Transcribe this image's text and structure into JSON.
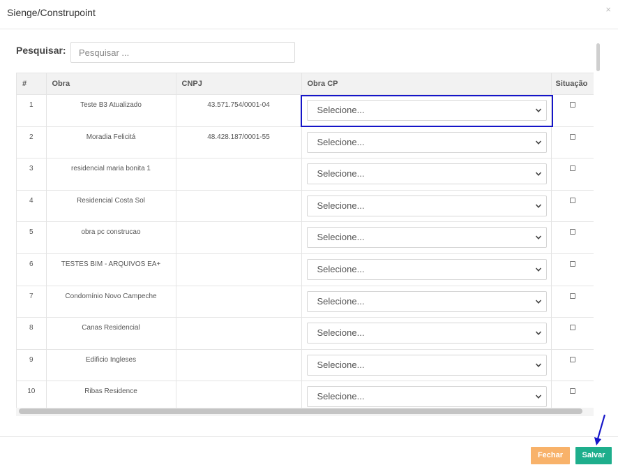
{
  "modal": {
    "title": "Sienge/Construpoint",
    "close_glyph": "×"
  },
  "search": {
    "label": "Pesquisar:",
    "placeholder": "Pesquisar ...",
    "value": ""
  },
  "table": {
    "columns": [
      "#",
      "Obra",
      "CNPJ",
      "Obra CP",
      "Situação"
    ],
    "rows": [
      {
        "num": "1",
        "obra": "Teste B3 Atualizado",
        "cnpj": "43.571.754/0001-04",
        "obra_cp": "Selecione..."
      },
      {
        "num": "2",
        "obra": "Moradia Felicitá",
        "cnpj": "48.428.187/0001-55",
        "obra_cp": "Selecione..."
      },
      {
        "num": "3",
        "obra": "residencial maria bonita 1",
        "cnpj": "",
        "obra_cp": "Selecione..."
      },
      {
        "num": "4",
        "obra": "Residencial Costa Sol",
        "cnpj": "",
        "obra_cp": "Selecione..."
      },
      {
        "num": "5",
        "obra": "obra pc construcao",
        "cnpj": "",
        "obra_cp": "Selecione..."
      },
      {
        "num": "6",
        "obra": "TESTES BIM - ARQUIVOS EA+",
        "cnpj": "",
        "obra_cp": "Selecione..."
      },
      {
        "num": "7",
        "obra": "Condomínio Novo Campeche",
        "cnpj": "",
        "obra_cp": "Selecione..."
      },
      {
        "num": "8",
        "obra": "Canas Residencial",
        "cnpj": "",
        "obra_cp": "Selecione..."
      },
      {
        "num": "9",
        "obra": "Edificio Ingleses",
        "cnpj": "",
        "obra_cp": "Selecione..."
      },
      {
        "num": "10",
        "obra": "Ribas Residence",
        "cnpj": "",
        "obra_cp": "Selecione..."
      }
    ]
  },
  "footer": {
    "close_label": "Fechar",
    "save_label": "Salvar"
  },
  "colors": {
    "close_button": "#f8b26a",
    "save_button": "#1eae8c",
    "highlight": "#1515c8"
  },
  "icons": {
    "select_arrow": "chevron-down-icon",
    "annotation": "arrow-icon"
  }
}
